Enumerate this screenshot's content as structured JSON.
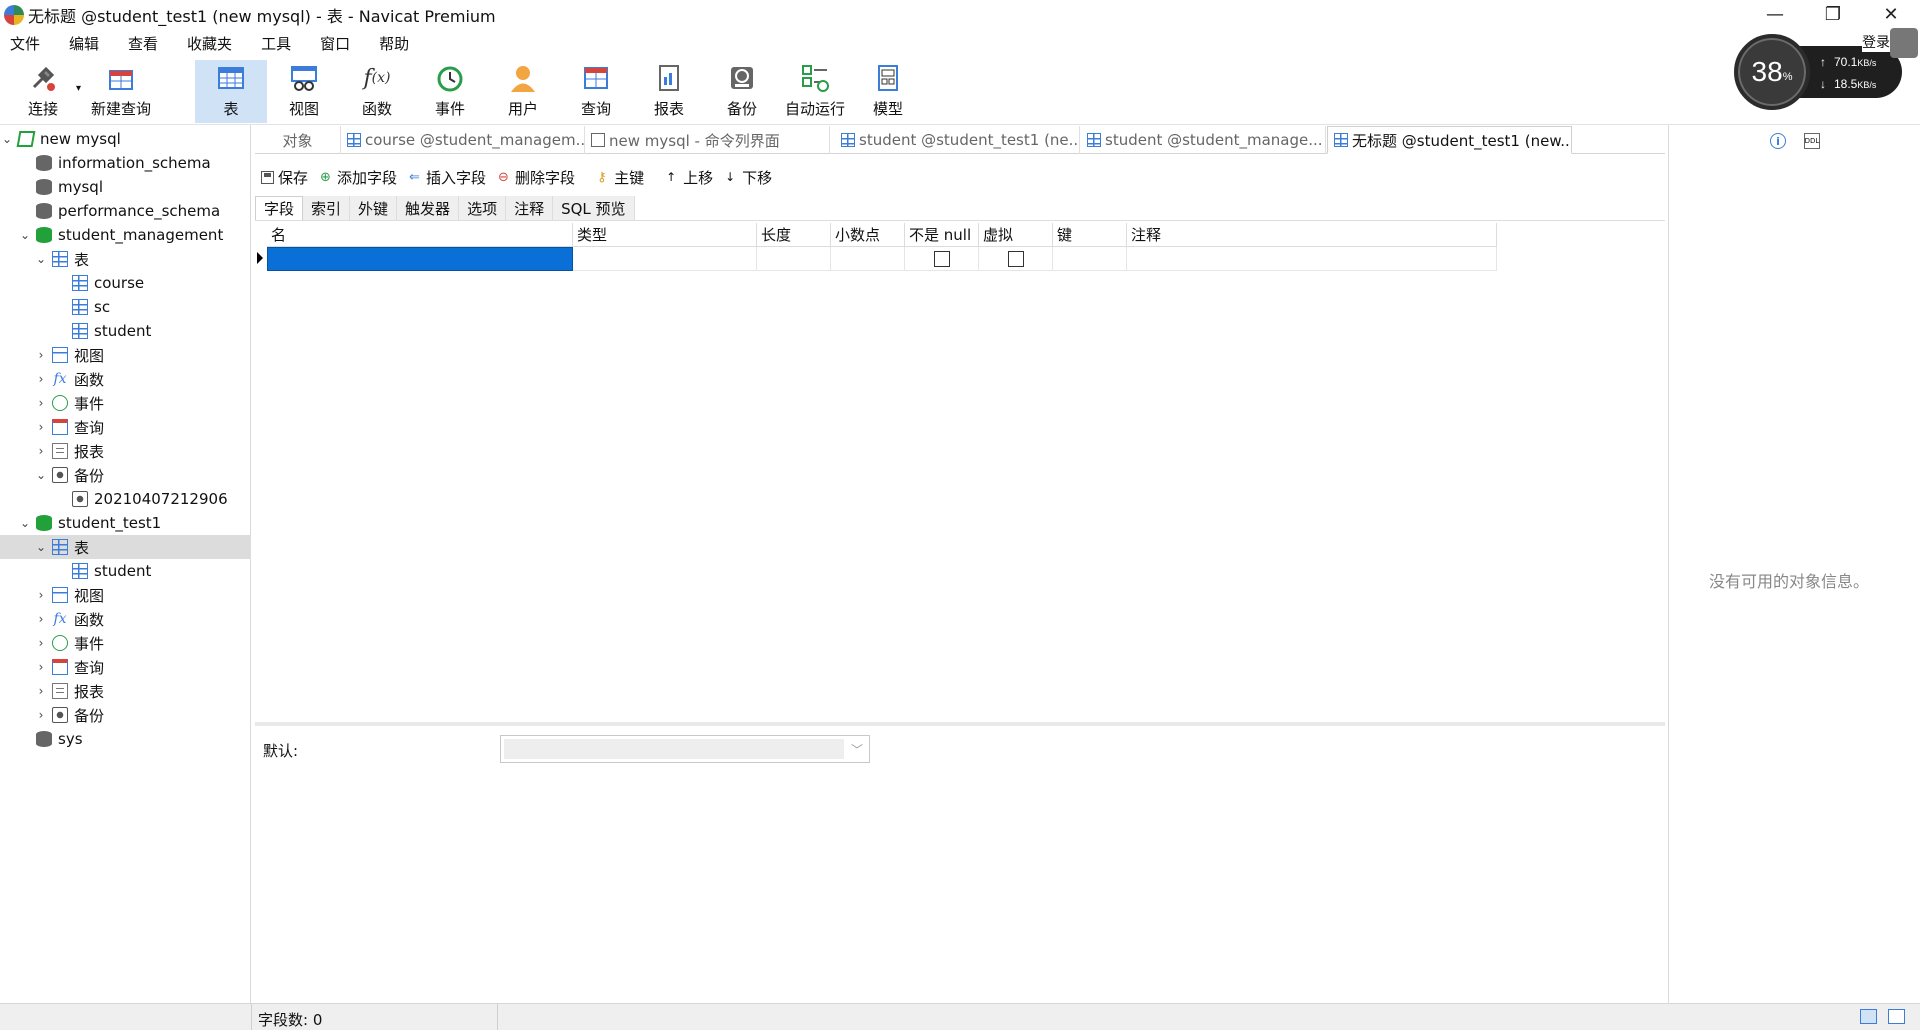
{
  "window": {
    "title": "无标题 @student_test1 (new mysql) - 表 - Navicat Premium",
    "login_label": "登录"
  },
  "menu": [
    "文件",
    "编辑",
    "查看",
    "收藏夹",
    "工具",
    "窗口",
    "帮助"
  ],
  "toolbar": {
    "connect": "连接",
    "new_query": "新建查询",
    "table": "表",
    "view": "视图",
    "function": "函数",
    "event": "事件",
    "user": "用户",
    "query": "查询",
    "report": "报表",
    "backup": "备份",
    "automation": "自动运行",
    "model": "模型"
  },
  "net_widget": {
    "percent": "38",
    "percent_unit": "%",
    "upload": "70.1",
    "download": "18.5",
    "unit": "KB/s"
  },
  "tree": {
    "connection": "new mysql",
    "dbs": {
      "information_schema": "information_schema",
      "mysql": "mysql",
      "performance_schema": "performance_schema",
      "student_management": "student_management",
      "student_test1": "student_test1",
      "sys": "sys"
    },
    "labels": {
      "tables": "表",
      "views": "视图",
      "functions": "函数",
      "events": "事件",
      "queries": "查询",
      "reports": "报表",
      "backups": "备份"
    },
    "sm_tables": [
      "course",
      "sc",
      "student"
    ],
    "sm_backup": "20210407212906",
    "st_tables": [
      "student"
    ]
  },
  "tabs": {
    "objects": "对象",
    "t1": "course @student_managem...",
    "t2": "new mysql - 命令列界面",
    "t3": "student @student_test1 (ne...",
    "t4": "student @student_manage...",
    "t5": "无标题 @student_test1 (new..."
  },
  "editor_toolbar": {
    "save": "保存",
    "add_field": "添加字段",
    "insert_field": "插入字段",
    "delete_field": "删除字段",
    "primary_key": "主键",
    "move_up": "上移",
    "move_down": "下移"
  },
  "subtabs": [
    "字段",
    "索引",
    "外键",
    "触发器",
    "选项",
    "注释",
    "SQL 预览"
  ],
  "grid": {
    "columns": {
      "name": "名",
      "type": "类型",
      "length": "长度",
      "decimals": "小数点",
      "not_null": "不是 null",
      "virtual": "虚拟",
      "key": "键",
      "comment": "注释"
    }
  },
  "default_label": "默认:",
  "info": {
    "empty": "没有可用的对象信息。"
  },
  "status": {
    "field_count": "字段数: 0"
  }
}
